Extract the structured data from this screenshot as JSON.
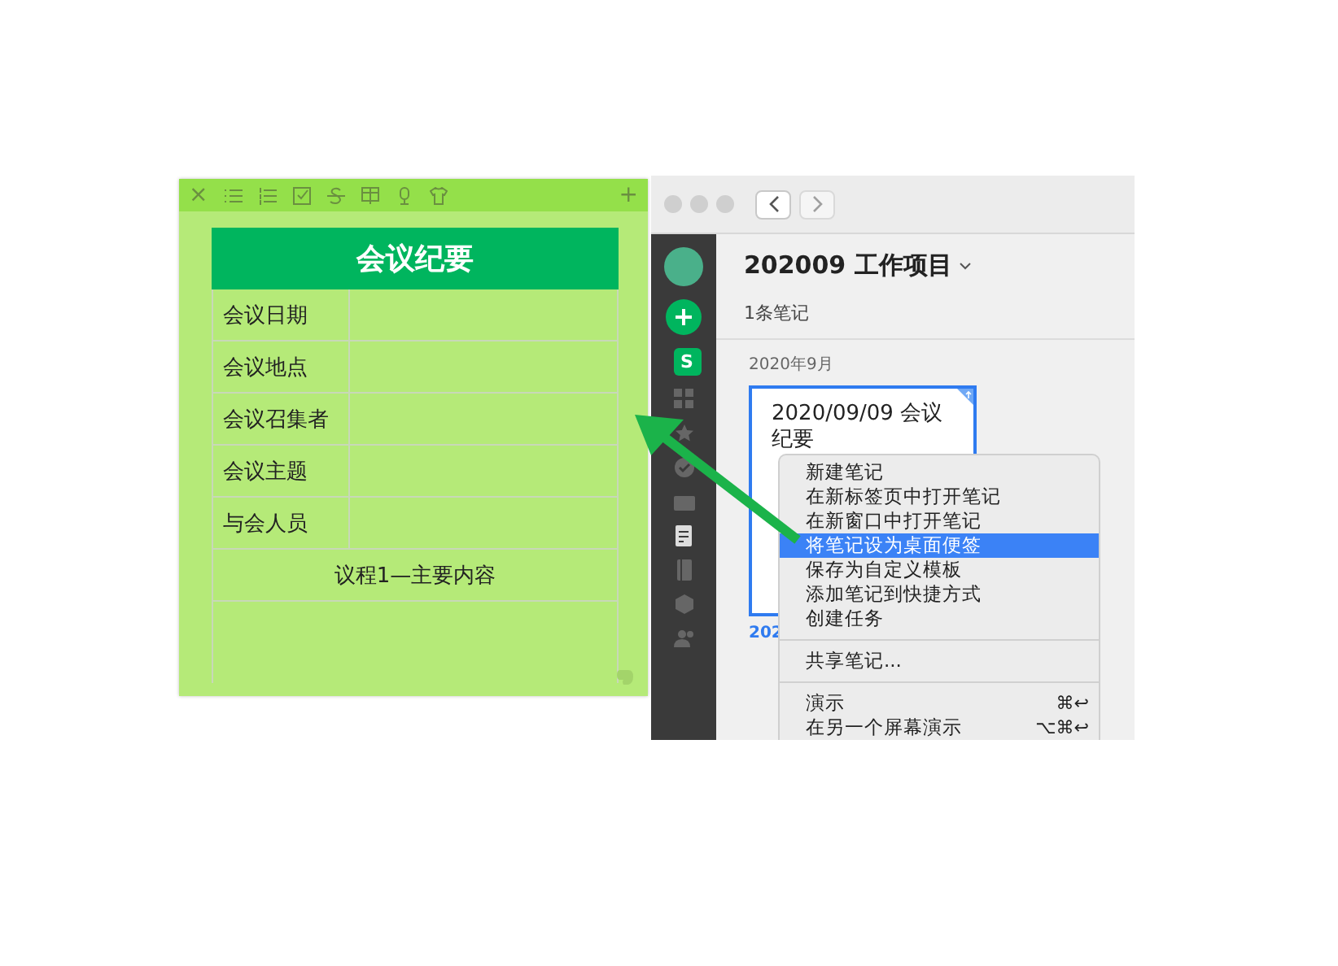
{
  "sticky_note": {
    "toolbar": {
      "close": "×",
      "add": "+"
    },
    "table": {
      "title": "会议纪要",
      "rows": [
        {
          "label": "会议日期"
        },
        {
          "label": "会议地点"
        },
        {
          "label": "会议召集者"
        },
        {
          "label": "会议主题"
        },
        {
          "label": "与会人员"
        }
      ],
      "agenda": "议程1—主要内容"
    }
  },
  "window": {
    "sidebar": {
      "shortcut_label": "S"
    },
    "title": "202009 工作项目",
    "note_count": "1条笔记",
    "section": "2020年9月",
    "note_card": {
      "title": "2020/09/09 会议纪要",
      "selected": true,
      "date": "202"
    }
  },
  "context_menu": {
    "groups": [
      [
        {
          "label": "新建笔记",
          "selected": false
        },
        {
          "label": "在新标签页中打开笔记",
          "selected": false
        },
        {
          "label": "在新窗口中打开笔记",
          "selected": false
        },
        {
          "label": "将笔记设为桌面便签",
          "selected": true
        },
        {
          "label": "保存为自定义模板",
          "selected": false
        },
        {
          "label": "添加笔记到快捷方式",
          "selected": false
        },
        {
          "label": "创建任务",
          "selected": false
        }
      ],
      [
        {
          "label": "共享笔记...",
          "selected": false
        }
      ],
      [
        {
          "label": "演示",
          "shortcut": "⌘↩",
          "selected": false
        },
        {
          "label": "在另一个屏幕演示",
          "shortcut": "⌥⌘↩",
          "selected": false
        }
      ]
    ]
  }
}
